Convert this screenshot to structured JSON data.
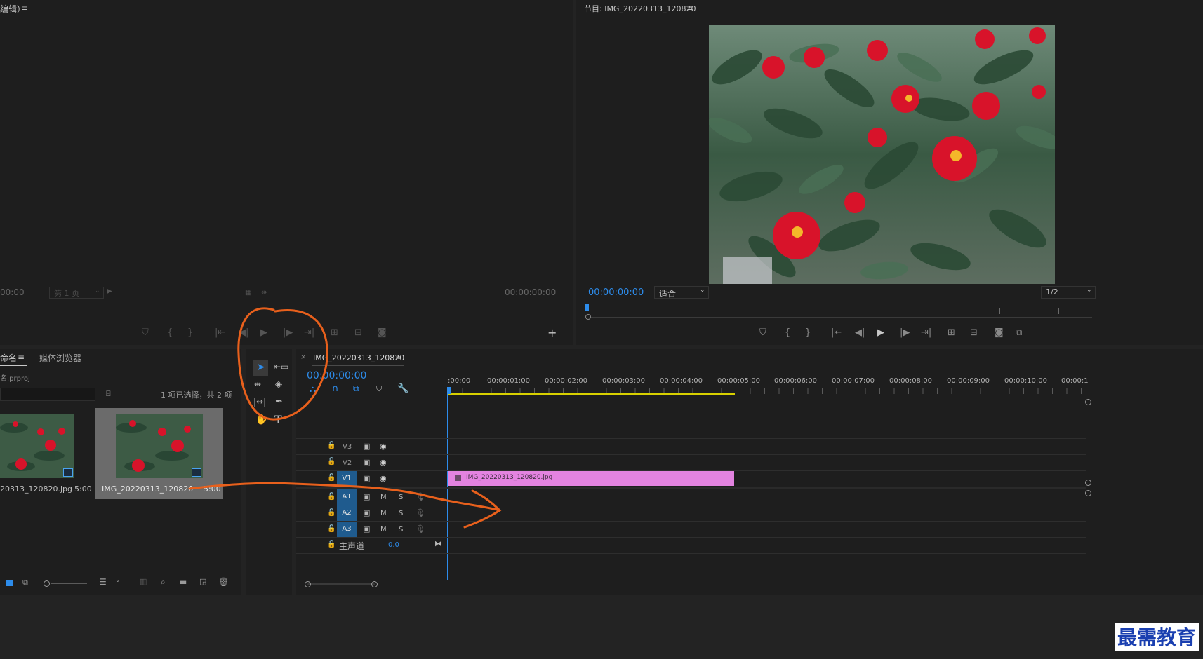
{
  "source_monitor": {
    "title": "编辑）",
    "timecode_left": "00:00",
    "page_select": "第 1 页",
    "timecode_right": "00:00:00:00"
  },
  "program_monitor": {
    "title": "节目: IMG_20220313_120820",
    "timecode": "00:00:00:00",
    "fit_select": "适合",
    "resolution_select": "1/2"
  },
  "project": {
    "tab_name": "命名",
    "tab_media_browser": "媒体浏览器",
    "project_file": "名.prproj",
    "selection_info": "1 项已选择，共 2 项",
    "items": [
      {
        "name": "20313_120820.jpg",
        "duration": "5:00"
      },
      {
        "name": "IMG_20220313_120820",
        "duration": "5:00"
      }
    ]
  },
  "timeline": {
    "sequence_name": "IMG_20220313_120820",
    "timecode": "00:00:00:00",
    "ruler_labels": [
      ":00:00",
      "00:00:01:00",
      "00:00:02:00",
      "00:00:03:00",
      "00:00:04:00",
      "00:00:05:00",
      "00:00:06:00",
      "00:00:07:00",
      "00:00:08:00",
      "00:00:09:00",
      "00:00:10:00",
      "00:00:1"
    ],
    "video_tracks": [
      "V3",
      "V2",
      "V1"
    ],
    "audio_tracks": [
      "A1",
      "A2",
      "A3"
    ],
    "audio_mute": "M",
    "audio_solo": "S",
    "master_label": "主声道",
    "master_value": "0.0",
    "clip_name": "IMG_20220313_120820.jpg"
  },
  "watermark": "最需教育",
  "colors": {
    "accent_blue": "#2d8ceb",
    "clip_pink": "#e383e0",
    "annotation_orange": "#e8601c",
    "work_area_yellow": "#d8d000"
  }
}
